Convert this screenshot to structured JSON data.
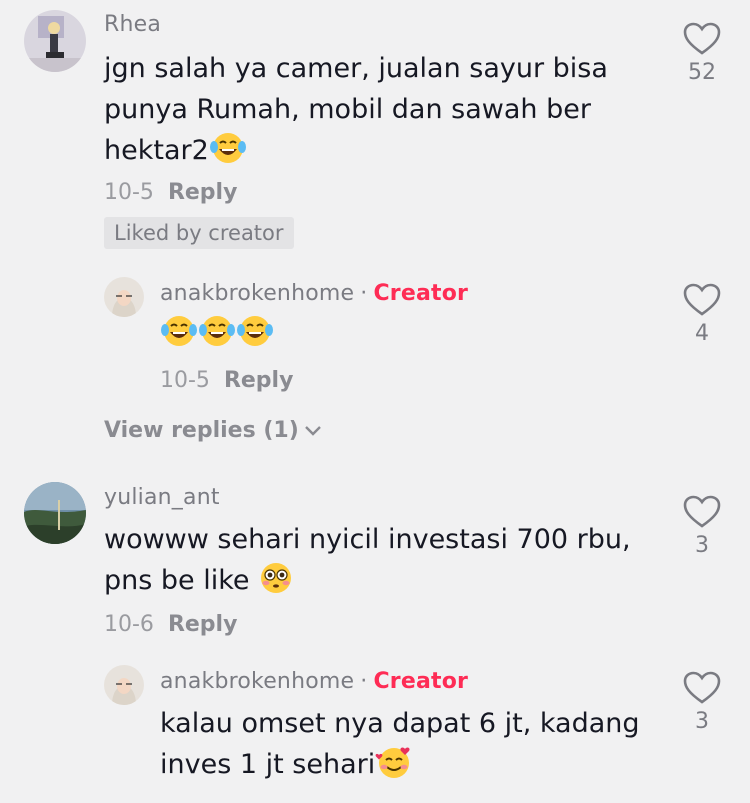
{
  "comments": [
    {
      "username": "Rhea",
      "text_lines": [
        "jgn salah ya camer, jualan sayur bisa",
        "punya Rumah, mobil dan sawah ber",
        "hektar2"
      ],
      "emoji": "laughing-tears",
      "date": "10-5",
      "reply_label": "Reply",
      "liked_by_creator": "Liked by creator",
      "likes": "52"
    },
    {
      "username": "anakbrokenhome",
      "creator_label": "Creator",
      "emojis": [
        "laughing-tears",
        "laughing-tears",
        "laughing-tears"
      ],
      "date": "10-5",
      "reply_label": "Reply",
      "likes": "4"
    },
    {
      "username": "yulian_ant",
      "text_lines": [
        "wowww sehari nyicil investasi 700 rbu,",
        "pns be like"
      ],
      "emoji": "flushed-face",
      "date": "10-6",
      "reply_label": "Reply",
      "likes": "3"
    },
    {
      "username": "anakbrokenhome",
      "creator_label": "Creator",
      "text_lines": [
        "kalau omset nya dapat 6 jt, kadang",
        "inves 1 jt sehari"
      ],
      "emoji": "smiling-face-with-hearts",
      "likes": "3"
    }
  ],
  "view_replies": "View replies (1)",
  "colors": {
    "background": "#f1f1f2",
    "creator": "#fe2c55",
    "text": "#161823",
    "muted": "#7a7b82"
  }
}
